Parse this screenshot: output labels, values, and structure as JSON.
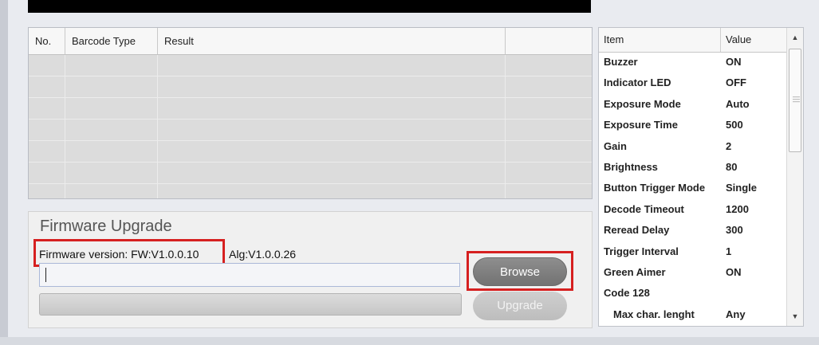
{
  "results_table": {
    "columns": [
      "No.",
      "Barcode Type",
      "Result",
      ""
    ]
  },
  "firmware": {
    "title": "Firmware Upgrade",
    "version_text": "Firmware version: FW:V1.0.0.10",
    "alg_text": "Alg:V1.0.0.26",
    "path_value": "",
    "browse_label": "Browse",
    "upgrade_label": "Upgrade"
  },
  "settings": {
    "header": {
      "item": "Item",
      "value": "Value"
    },
    "rows": [
      {
        "item": "Buzzer",
        "value": "ON"
      },
      {
        "item": "Indicator LED",
        "value": "OFF"
      },
      {
        "item": "Exposure Mode",
        "value": "Auto"
      },
      {
        "item": "Exposure Time",
        "value": "500"
      },
      {
        "item": "Gain",
        "value": "2"
      },
      {
        "item": "Brightness",
        "value": "80"
      },
      {
        "item": "Button Trigger Mode",
        "value": "Single"
      },
      {
        "item": "Decode Timeout",
        "value": "1200"
      },
      {
        "item": "Reread Delay",
        "value": "300"
      },
      {
        "item": "Trigger Interval",
        "value": "1"
      },
      {
        "item": "Green Aimer",
        "value": "ON"
      },
      {
        "item": "Code 128",
        "value": ""
      },
      {
        "item": "Max char. lenght",
        "value": "Any"
      }
    ]
  },
  "icons": {
    "scroll_up": "triangle-up",
    "scroll_down": "triangle-down"
  },
  "colors": {
    "highlight": "#d62020",
    "button": "#7f7f7f"
  }
}
